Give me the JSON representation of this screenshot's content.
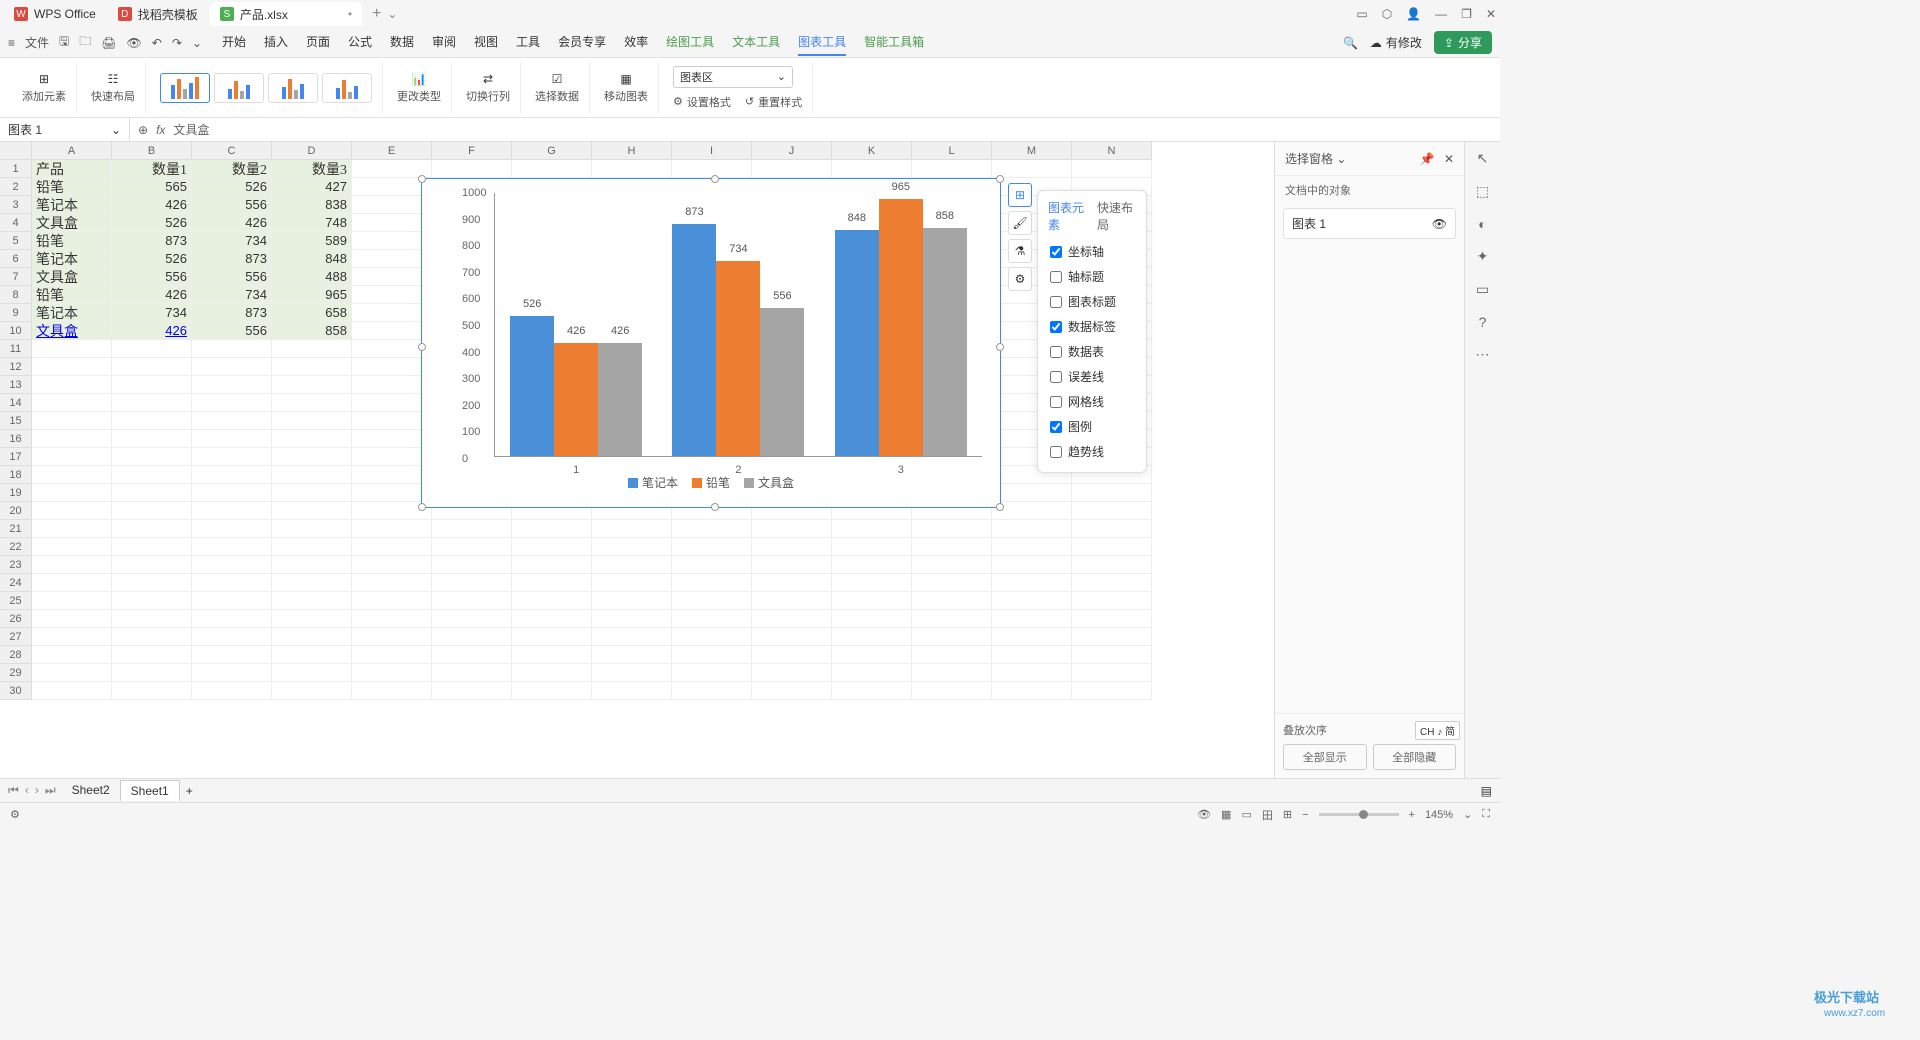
{
  "app": {
    "name": "WPS Office"
  },
  "tabs": [
    {
      "label": "找稻壳模板",
      "icon_bg": "#d94b3f",
      "icon_text": "D"
    },
    {
      "label": "产品.xlsx",
      "icon_bg": "#4caf50",
      "icon_text": "S",
      "active": true
    }
  ],
  "window_controls": {
    "minimize": "—",
    "maximize": "❐",
    "close": "✕"
  },
  "menu": {
    "file": "文件",
    "items": [
      "开始",
      "插入",
      "页面",
      "公式",
      "数据",
      "审阅",
      "视图",
      "工具",
      "会员专享",
      "效率",
      "绘图工具",
      "文本工具",
      "图表工具",
      "智能工具箱"
    ],
    "active": "图表工具",
    "green": [
      "绘图工具",
      "文本工具",
      "图表工具",
      "智能工具箱"
    ],
    "has_changes": "有修改",
    "share": "分享"
  },
  "ribbon": {
    "add_element": "添加元素",
    "quick_layout": "快速布局",
    "change_type": "更改类型",
    "switch_rowcol": "切换行列",
    "select_data": "选择数据",
    "move_chart": "移动图表",
    "chart_area": "图表区",
    "set_format": "设置格式",
    "reset_style": "重置样式"
  },
  "namebox": "图表 1",
  "formula": "文具盒",
  "columns": [
    "A",
    "B",
    "C",
    "D",
    "E",
    "F",
    "G",
    "H",
    "I",
    "J",
    "K",
    "L",
    "M",
    "N"
  ],
  "sheet_data": {
    "headers": [
      "产品",
      "数量1",
      "数量2",
      "数量3"
    ],
    "rows": [
      [
        "铅笔",
        565,
        526,
        427
      ],
      [
        "笔记本",
        426,
        556,
        838
      ],
      [
        "文具盒",
        526,
        426,
        748
      ],
      [
        "铅笔",
        873,
        734,
        589
      ],
      [
        "笔记本",
        526,
        873,
        848
      ],
      [
        "文具盒",
        556,
        556,
        488
      ],
      [
        "铅笔",
        426,
        734,
        965
      ],
      [
        "笔记本",
        734,
        873,
        658
      ],
      [
        "文具盒",
        426,
        556,
        858
      ]
    ]
  },
  "chart_elements_popup": {
    "tab1": "图表元素",
    "tab2": "快速布局",
    "items": [
      {
        "label": "坐标轴",
        "checked": true
      },
      {
        "label": "轴标题",
        "checked": false
      },
      {
        "label": "图表标题",
        "checked": false
      },
      {
        "label": "数据标签",
        "checked": true
      },
      {
        "label": "数据表",
        "checked": false
      },
      {
        "label": "误差线",
        "checked": false
      },
      {
        "label": "网格线",
        "checked": false
      },
      {
        "label": "图例",
        "checked": true
      },
      {
        "label": "趋势线",
        "checked": false
      }
    ]
  },
  "right_panel": {
    "title": "选择窗格",
    "subtitle": "文档中的对象",
    "item": "图表 1",
    "stack_order": "叠放次序",
    "show_all": "全部显示",
    "hide_all": "全部隐藏"
  },
  "sheets": {
    "list": [
      "Sheet2",
      "Sheet1"
    ],
    "active": "Sheet1",
    "add": "+"
  },
  "status": {
    "zoom": "145%",
    "ime": "CH ♪ 简"
  },
  "chart_data": {
    "type": "bar",
    "categories": [
      "1",
      "2",
      "3"
    ],
    "series": [
      {
        "name": "笔记本",
        "color": "#4a90d9",
        "values": [
          526,
          873,
          848
        ]
      },
      {
        "name": "铅笔",
        "color": "#ed7d31",
        "values": [
          426,
          734,
          965
        ]
      },
      {
        "name": "文具盒",
        "color": "#a5a5a5",
        "values": [
          426,
          556,
          858
        ]
      }
    ],
    "ylim": [
      0,
      1000
    ],
    "yticks": [
      0,
      100,
      200,
      300,
      400,
      500,
      600,
      700,
      800,
      900,
      1000
    ]
  },
  "watermark": {
    "line1": "极光下载站",
    "line2": "www.xz7.com"
  }
}
